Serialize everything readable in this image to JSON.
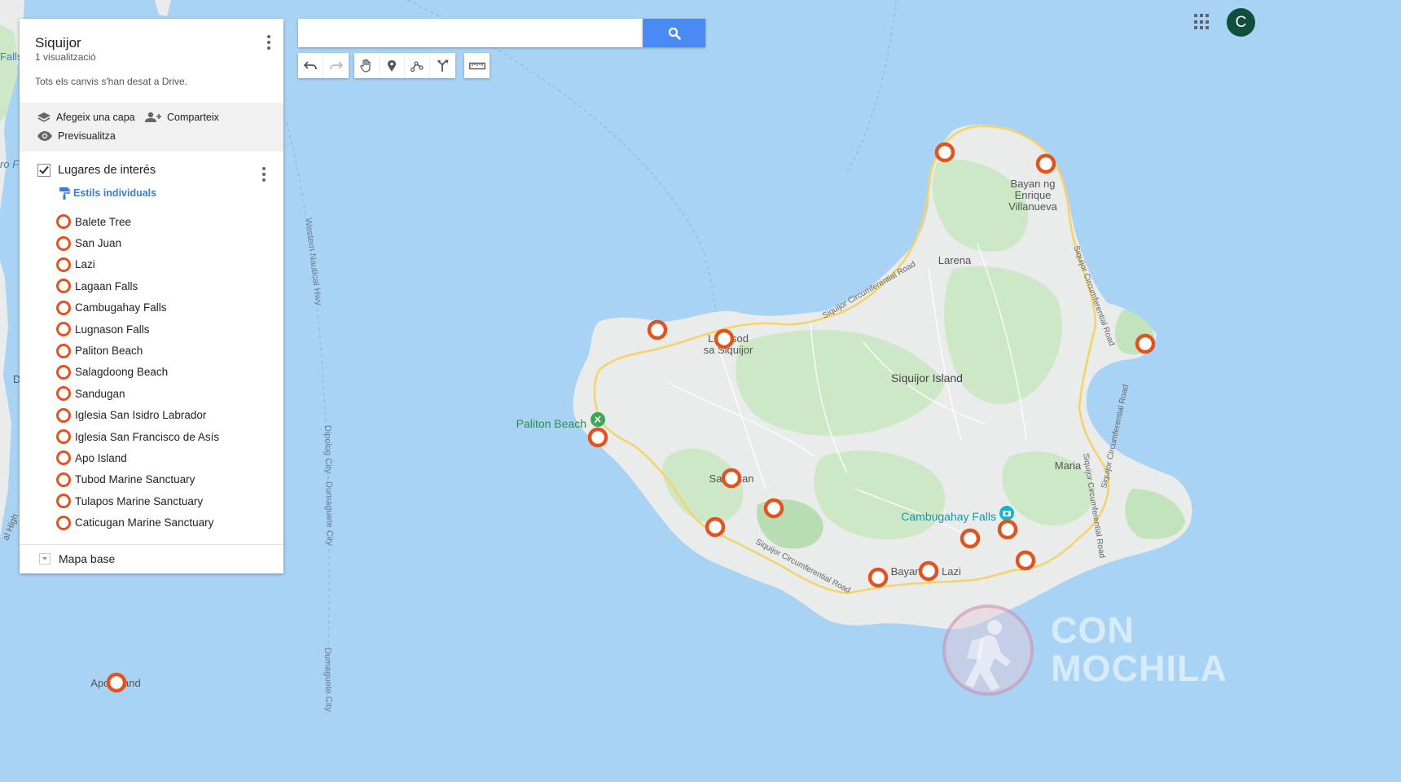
{
  "map": {
    "title": "Siquijor",
    "views": "1 visualització",
    "saved_status": "Tots els canvis s'han desat a Drive.",
    "actions": {
      "add_layer": "Afegeix una capa",
      "share": "Comparteix",
      "preview": "Previsualitza"
    },
    "layer": {
      "name": "Lugares de interés",
      "style": "Estils individuals",
      "places": [
        "Balete Tree",
        "San Juan",
        "Lazi",
        "Lagaan Falls",
        "Cambugahay Falls",
        "Lugnason Falls",
        "Paliton Beach",
        "Salagdoong Beach",
        "Sandugan",
        "Iglesia San Isidro Labrador",
        "Iglesia San Francisco de Asís",
        "Apo Island",
        "Tubod Marine Sanctuary",
        "Tulapos Marine Sanctuary",
        "Caticugan Marine Sanctuary"
      ],
      "marker_color": "#e2541f"
    },
    "base_map": "Mapa base"
  },
  "search": {
    "value": "",
    "placeholder": ""
  },
  "toolbar": [
    "undo-icon",
    "redo-icon",
    "hand-icon",
    "marker-icon",
    "draw-line-icon",
    "directions-icon",
    "ruler-icon"
  ],
  "user": {
    "initial": "C"
  },
  "map_labels": {
    "edge_left_top": "Falls",
    "edge_left_mid": "ro F",
    "edge_left_d": "D",
    "edge_left_highway": "al High",
    "western_hwy": "Western Nautical Hwy",
    "dipolog_road": "Dipolog City - Dumaguete City",
    "dipolog_road_2": "Dumaguete City",
    "bayan_enrique": [
      "Bayan ng",
      "Enrique",
      "Villanueva"
    ],
    "larena": "Larena",
    "siquijor_town": [
      "Lungsod",
      "sa Siquijor"
    ],
    "siquijor_island": "Siquijor Island",
    "paliton": "Paliton Beach",
    "san_juan": "San Juan",
    "maria": "Maria",
    "cambugahay": "Cambugahay Falls",
    "bayan": "Bayan",
    "lazi": "Lazi",
    "apo_island": "Apo Island",
    "circ_road": "Siquijor Circumferential Road",
    "circ_road_2": "Siquijor Circumferential Road",
    "circ_road_3": "Siquijor Circumferential Road",
    "circ_road_4": "Siquijor Circumferential Road",
    "circ_road_5": "Siquijor Circumferential Road"
  },
  "watermark": [
    "CON",
    "MOCHILA"
  ],
  "colors": {
    "water": "#a9d3f5",
    "land": "#e9ecea",
    "forest": "#cde8c6",
    "road": "#f4d36b",
    "search_button": "#4a8af4",
    "avatar": "#0f4f3e"
  }
}
